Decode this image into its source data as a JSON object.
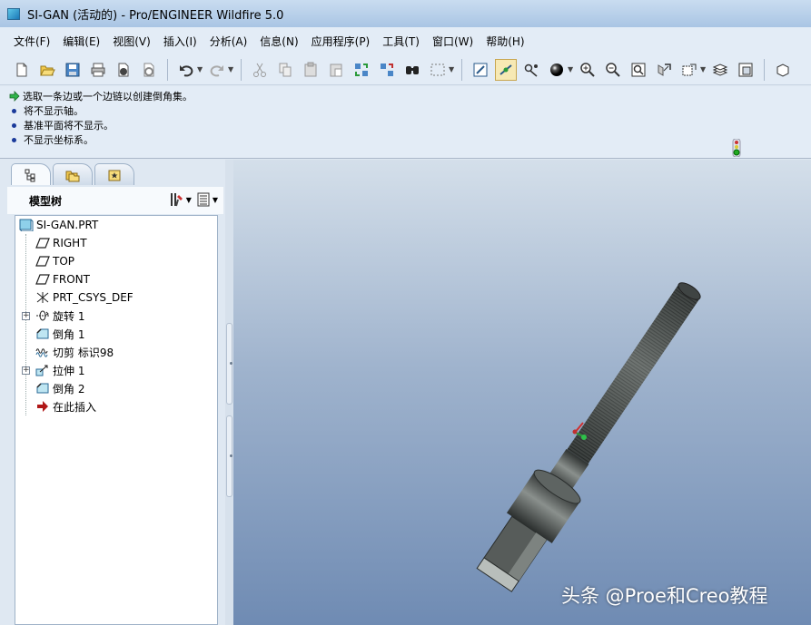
{
  "window": {
    "title": "SI-GAN (活动的) - Pro/ENGINEER Wildfire 5.0"
  },
  "menubar": {
    "items": [
      "文件(F)",
      "编辑(E)",
      "视图(V)",
      "插入(I)",
      "分析(A)",
      "信息(N)",
      "应用程序(P)",
      "工具(T)",
      "窗口(W)",
      "帮助(H)"
    ]
  },
  "toolbar": {
    "icons": [
      "new-icon",
      "open-icon",
      "save-icon",
      "print-icon",
      "send-email-icon",
      "send-link-icon",
      "undo-icon",
      "redo-icon",
      "cut-icon",
      "copy-icon",
      "paste-icon",
      "paste-special-icon",
      "regenerate-icon",
      "regen-manager-icon",
      "find-icon",
      "select-box-icon",
      "repaint-icon",
      "spin-center-icon",
      "orient-mode-icon",
      "display-style-icon",
      "zoom-in-icon",
      "zoom-out-icon",
      "refit-icon",
      "reorient-icon",
      "saved-views-icon",
      "layers-icon",
      "view-manager-icon",
      "datum-display-icon"
    ]
  },
  "messages": {
    "prompt": "选取一条边或一个边链以创建倒角集。",
    "lines": [
      "将不显示轴。",
      "基准平面将不显示。",
      "不显示坐标系。"
    ]
  },
  "model_tree": {
    "title": "模型树",
    "root": "SI-GAN.PRT",
    "items": [
      {
        "label": "RIGHT",
        "icon": "datum-plane-icon",
        "expandable": false
      },
      {
        "label": "TOP",
        "icon": "datum-plane-icon",
        "expandable": false
      },
      {
        "label": "FRONT",
        "icon": "datum-plane-icon",
        "expandable": false
      },
      {
        "label": "PRT_CSYS_DEF",
        "icon": "csys-icon",
        "expandable": false
      },
      {
        "label": "旋转 1",
        "icon": "revolve-icon",
        "expandable": true
      },
      {
        "label": "倒角 1",
        "icon": "chamfer-icon",
        "expandable": false
      },
      {
        "label": "切剪 标识98",
        "icon": "cut-sweep-icon",
        "expandable": false
      },
      {
        "label": "拉伸 1",
        "icon": "extrude-icon",
        "expandable": true
      },
      {
        "label": "倒角 2",
        "icon": "chamfer-icon",
        "expandable": false
      },
      {
        "label": "在此插入",
        "icon": "insert-here-icon",
        "expandable": false
      }
    ]
  },
  "watermark": "头条 @Proe和Creo教程",
  "colors": {
    "viewport_top": "#d4dfea",
    "viewport_bottom": "#6f8bb3",
    "model_body": "#4f5452",
    "model_highlight": "#8a908d"
  }
}
